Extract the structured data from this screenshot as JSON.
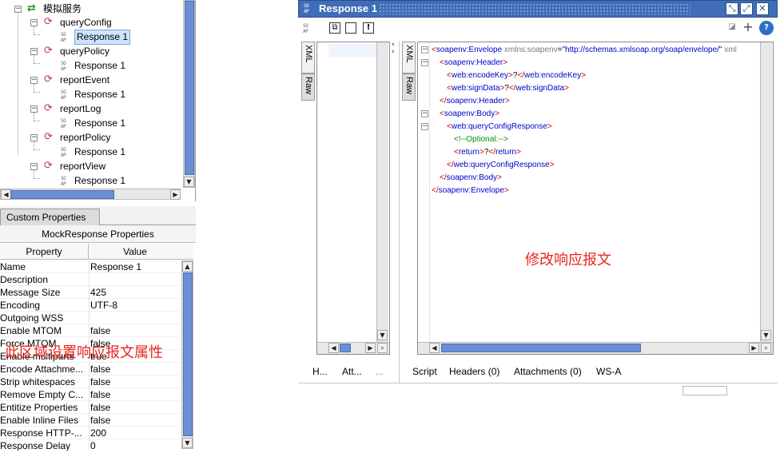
{
  "tree": {
    "service": "模拟服务",
    "operations": [
      {
        "name": "queryConfig",
        "response": "Response 1"
      },
      {
        "name": "queryPolicy",
        "response": "Response 1"
      },
      {
        "name": "reportEvent",
        "response": "Response 1"
      },
      {
        "name": "reportLog",
        "response": "Response 1"
      },
      {
        "name": "reportPolicy",
        "response": "Response 1"
      },
      {
        "name": "reportView",
        "response": "Response 1"
      }
    ]
  },
  "props": {
    "tab": "Custom Properties",
    "title": "MockResponse Properties",
    "col_property": "Property",
    "col_value": "Value",
    "rows": [
      {
        "name": "Name",
        "value": "Response 1"
      },
      {
        "name": "Description",
        "value": ""
      },
      {
        "name": "Message Size",
        "value": "425"
      },
      {
        "name": "Encoding",
        "value": "UTF-8"
      },
      {
        "name": "Outgoing WSS",
        "value": ""
      },
      {
        "name": "Enable MTOM",
        "value": "false"
      },
      {
        "name": "Force MTOM",
        "value": "false"
      },
      {
        "name": "Enable multiparts",
        "value": "true"
      },
      {
        "name": "Encode Attachme...",
        "value": "false"
      },
      {
        "name": "Strip whitespaces",
        "value": "false"
      },
      {
        "name": "Remove Empty C...",
        "value": "false"
      },
      {
        "name": "Entitize Properties",
        "value": "false"
      },
      {
        "name": "Enable Inline Files",
        "value": "false"
      },
      {
        "name": "Response HTTP-...",
        "value": "200"
      },
      {
        "name": "Response Delay",
        "value": "0"
      }
    ]
  },
  "annotations": {
    "left": "此区域设置响应报文属性",
    "right": "修改响应报文"
  },
  "editor": {
    "title": "Response 1",
    "side_tabs": {
      "xml": "XML",
      "raw": "Raw"
    },
    "xml_lines": [
      {
        "fold": "−",
        "parts": [
          {
            "c": "brk",
            "t": "<"
          },
          {
            "c": "tag",
            "t": "soapenv:Envelope"
          },
          {
            "c": "attr",
            "t": " xmlns:soapenv"
          },
          {
            "c": "txt",
            "t": "="
          },
          {
            "c": "attrval",
            "t": "\"http://schemas.xmlsoap.org/soap/envelope/\""
          },
          {
            "c": "attr",
            "t": " xml"
          }
        ]
      },
      {
        "fold": "−",
        "parts": [
          {
            "c": "brk",
            "t": "<"
          },
          {
            "c": "tag",
            "t": "soapenv:Header"
          },
          {
            "c": "brk",
            "t": ">"
          }
        ]
      },
      {
        "fold": "",
        "parts": [
          {
            "c": "brk",
            "t": "<"
          },
          {
            "c": "tag",
            "t": "web:encodeKey"
          },
          {
            "c": "brk",
            "t": ">"
          },
          {
            "c": "txt",
            "t": "?"
          },
          {
            "c": "brk",
            "t": "</"
          },
          {
            "c": "tag",
            "t": "web:encodeKey"
          },
          {
            "c": "brk",
            "t": ">"
          }
        ]
      },
      {
        "fold": "",
        "parts": [
          {
            "c": "brk",
            "t": "<"
          },
          {
            "c": "tag",
            "t": "web:signData"
          },
          {
            "c": "brk",
            "t": ">"
          },
          {
            "c": "txt",
            "t": "?"
          },
          {
            "c": "brk",
            "t": "</"
          },
          {
            "c": "tag",
            "t": "web:signData"
          },
          {
            "c": "brk",
            "t": ">"
          }
        ]
      },
      {
        "fold": "",
        "parts": [
          {
            "c": "brk",
            "t": "</"
          },
          {
            "c": "tag",
            "t": "soapenv:Header"
          },
          {
            "c": "brk",
            "t": ">"
          }
        ]
      },
      {
        "fold": "−",
        "parts": [
          {
            "c": "brk",
            "t": "<"
          },
          {
            "c": "tag",
            "t": "soapenv:Body"
          },
          {
            "c": "brk",
            "t": ">"
          }
        ]
      },
      {
        "fold": "−",
        "parts": [
          {
            "c": "brk",
            "t": "<"
          },
          {
            "c": "tag",
            "t": "web:queryConfigResponse"
          },
          {
            "c": "brk",
            "t": ">"
          }
        ]
      },
      {
        "fold": "",
        "parts": [
          {
            "c": "cmt",
            "t": "<!--Optional:-->"
          }
        ]
      },
      {
        "fold": "",
        "parts": [
          {
            "c": "brk",
            "t": "<"
          },
          {
            "c": "tag",
            "t": "return"
          },
          {
            "c": "brk",
            "t": ">"
          },
          {
            "c": "txt",
            "t": "?"
          },
          {
            "c": "brk",
            "t": "</"
          },
          {
            "c": "tag",
            "t": "return"
          },
          {
            "c": "brk",
            "t": ">"
          }
        ]
      },
      {
        "fold": "",
        "parts": [
          {
            "c": "brk",
            "t": "</"
          },
          {
            "c": "tag",
            "t": "web:queryConfigResponse"
          },
          {
            "c": "brk",
            "t": ">"
          }
        ]
      },
      {
        "fold": "",
        "parts": [
          {
            "c": "brk",
            "t": "</"
          },
          {
            "c": "tag",
            "t": "soapenv:Body"
          },
          {
            "c": "brk",
            "t": ">"
          }
        ]
      },
      {
        "fold": "",
        "parts": [
          {
            "c": "brk",
            "t": "</"
          },
          {
            "c": "tag",
            "t": "soapenv:Envelope"
          },
          {
            "c": "brk",
            "t": ">"
          }
        ]
      }
    ],
    "left_bottom_tabs": {
      "headers": "H...",
      "attachments": "Att...",
      "more": "..."
    },
    "right_bottom_tabs": {
      "script": "Script",
      "headers": "Headers (0)",
      "attachments": "Attachments (0)",
      "ws_a": "WS-A"
    }
  },
  "icons": {
    "tree_service": "mock-service-icon",
    "tree_operation": "operation-icon",
    "tree_response": "mock-response-icon",
    "window": "soap-icon"
  },
  "colors": {
    "title_bar": "#3f6db8",
    "scroll_thumb": "#6b8fd4",
    "annotation": "#e8251c",
    "xml_tag": "#0000c8",
    "xml_bracket": "#c80000",
    "xml_comment": "#009000"
  }
}
